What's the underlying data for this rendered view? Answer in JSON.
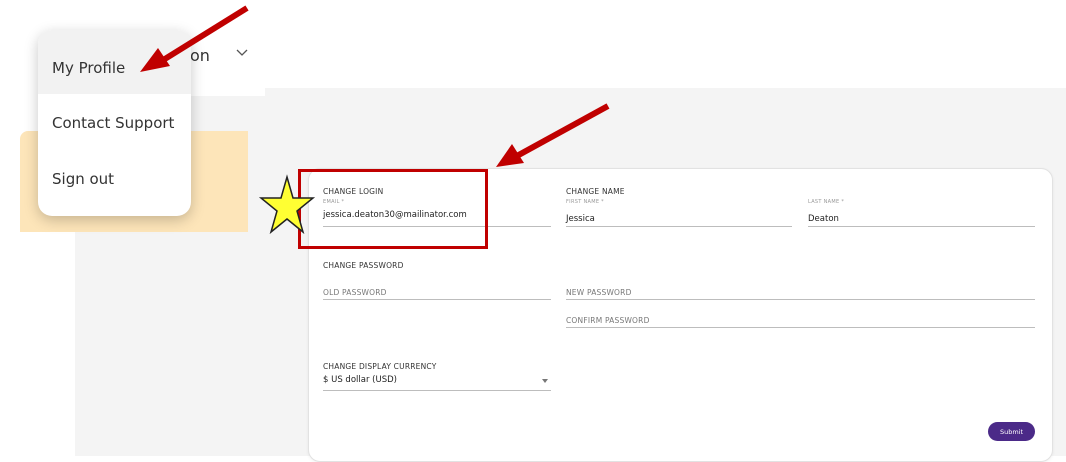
{
  "header": {
    "username_fragment": "on"
  },
  "menu": {
    "items": [
      "My Profile",
      "Contact Support",
      "Sign out"
    ]
  },
  "form": {
    "change_login": {
      "section": "CHANGE LOGIN",
      "email_label": "EMAIL *",
      "email_value": "jessica.deaton30@mailinator.com"
    },
    "change_name": {
      "section": "CHANGE NAME",
      "first_label": "FIRST NAME *",
      "first_value": "Jessica",
      "last_label": "LAST NAME *",
      "last_value": "Deaton"
    },
    "change_password": {
      "section": "CHANGE PASSWORD",
      "old_placeholder": "OLD PASSWORD",
      "new_placeholder": "NEW PASSWORD",
      "confirm_placeholder": "CONFIRM PASSWORD"
    },
    "currency": {
      "section": "CHANGE DISPLAY CURRENCY",
      "selected": "$ US dollar (USD)"
    },
    "submit_label": "Submit"
  },
  "annotations": {
    "arrow_color": "#c00000",
    "box_color": "#c00000",
    "star_color": "#ffff33"
  },
  "colors": {
    "accent": "#4b2a88",
    "highlight_card": "#fde5b9"
  }
}
